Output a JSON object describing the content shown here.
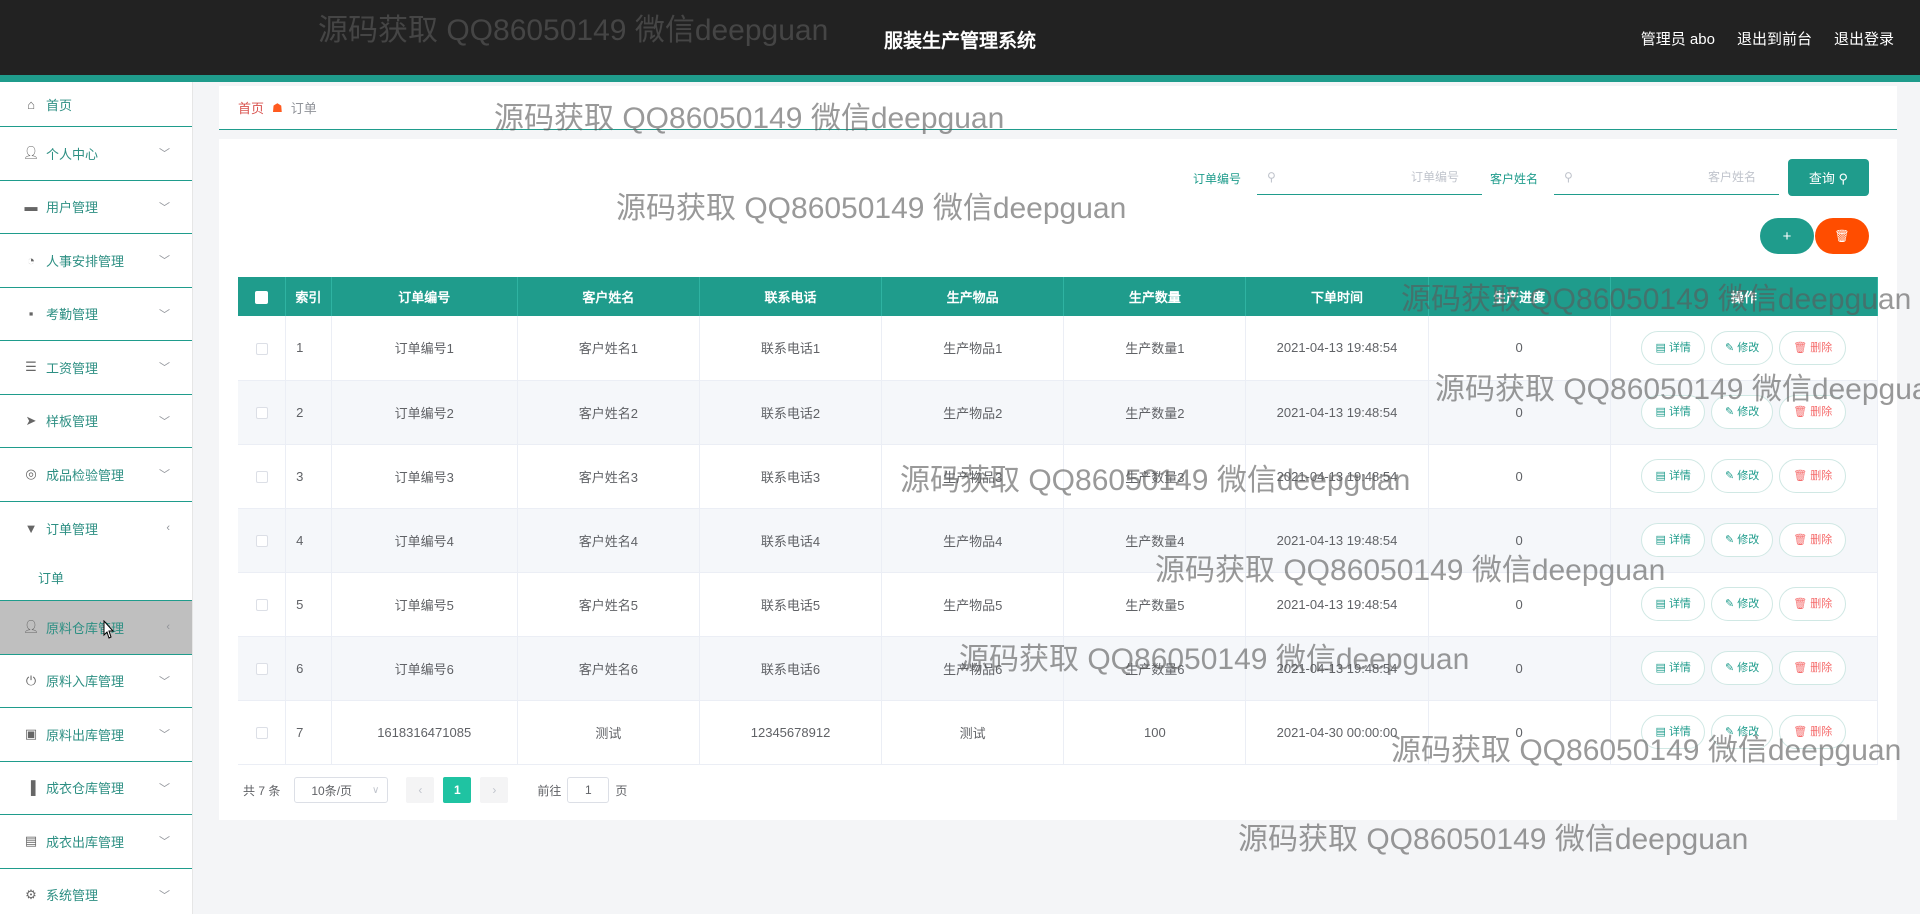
{
  "header": {
    "title": "服装生产管理系统",
    "user": "管理员 abo",
    "back_to_front": "退出到前台",
    "logout": "退出登录"
  },
  "sidebar": {
    "items": [
      {
        "label": "首页",
        "icon": "home-icon"
      },
      {
        "label": "个人中心",
        "icon": "user-icon"
      },
      {
        "label": "用户管理",
        "icon": "monitor-icon"
      },
      {
        "label": "人事安排管理",
        "icon": "gauge-icon"
      },
      {
        "label": "考勤管理",
        "icon": "chat-icon"
      },
      {
        "label": "工资管理",
        "icon": "list-icon"
      },
      {
        "label": "样板管理",
        "icon": "send-icon"
      },
      {
        "label": "成品检验管理",
        "icon": "target-icon"
      },
      {
        "label": "订单管理",
        "icon": "flag-icon"
      },
      {
        "label": "原料仓库管理",
        "icon": "user-icon"
      },
      {
        "label": "原料入库管理",
        "icon": "power-icon"
      },
      {
        "label": "原料出库管理",
        "icon": "box-icon"
      },
      {
        "label": "成衣仓库管理",
        "icon": "bar-chart-icon"
      },
      {
        "label": "成衣出库管理",
        "icon": "clipboard-icon"
      },
      {
        "label": "系统管理",
        "icon": "gear-icon"
      }
    ],
    "order_sub": "订单"
  },
  "breadcrumb": {
    "home": "首页",
    "current": "订单"
  },
  "search": {
    "order_label": "订单编号",
    "order_placeholder": "订单编号",
    "customer_label": "客户姓名",
    "customer_placeholder": "客户姓名",
    "query_label": "查询 ⚲",
    "add_label": "+",
    "delete_label": "🗑"
  },
  "table": {
    "columns": [
      "索引",
      "订单编号",
      "客户姓名",
      "联系电话",
      "生产物品",
      "生产数量",
      "下单时间",
      "生产进度",
      "操作"
    ],
    "rows": [
      {
        "idx": "1",
        "order": "订单编号1",
        "customer": "客户姓名1",
        "phone": "联系电话1",
        "item": "生产物品1",
        "qty": "生产数量1",
        "time": "2021-04-13 19:48:54",
        "progress": "0"
      },
      {
        "idx": "2",
        "order": "订单编号2",
        "customer": "客户姓名2",
        "phone": "联系电话2",
        "item": "生产物品2",
        "qty": "生产数量2",
        "time": "2021-04-13 19:48:54",
        "progress": "0"
      },
      {
        "idx": "3",
        "order": "订单编号3",
        "customer": "客户姓名3",
        "phone": "联系电话3",
        "item": "生产物品3",
        "qty": "生产数量3",
        "time": "2021-04-13 19:48:54",
        "progress": "0"
      },
      {
        "idx": "4",
        "order": "订单编号4",
        "customer": "客户姓名4",
        "phone": "联系电话4",
        "item": "生产物品4",
        "qty": "生产数量4",
        "time": "2021-04-13 19:48:54",
        "progress": "0"
      },
      {
        "idx": "5",
        "order": "订单编号5",
        "customer": "客户姓名5",
        "phone": "联系电话5",
        "item": "生产物品5",
        "qty": "生产数量5",
        "time": "2021-04-13 19:48:54",
        "progress": "0"
      },
      {
        "idx": "6",
        "order": "订单编号6",
        "customer": "客户姓名6",
        "phone": "联系电话6",
        "item": "生产物品6",
        "qty": "生产数量6",
        "time": "2021-04-13 19:48:54",
        "progress": "0"
      },
      {
        "idx": "7",
        "order": "1618316471085",
        "customer": "测试",
        "phone": "12345678912",
        "item": "测试",
        "qty": "100",
        "time": "2021-04-30 00:00:00",
        "progress": "0"
      }
    ],
    "actions": {
      "detail": "详情",
      "edit": "修改",
      "delete": "删除"
    }
  },
  "pagination": {
    "total": "共 7 条",
    "page_size": "10条/页",
    "current_page": "1",
    "goto_label": "前往",
    "goto_value": "1",
    "page_suffix": "页"
  },
  "watermark": "源码获取 QQ86050149 微信deepguan",
  "colors": {
    "accent": "#1f9c8c",
    "header_bg": "#222222",
    "danger": "#ff4d00"
  }
}
